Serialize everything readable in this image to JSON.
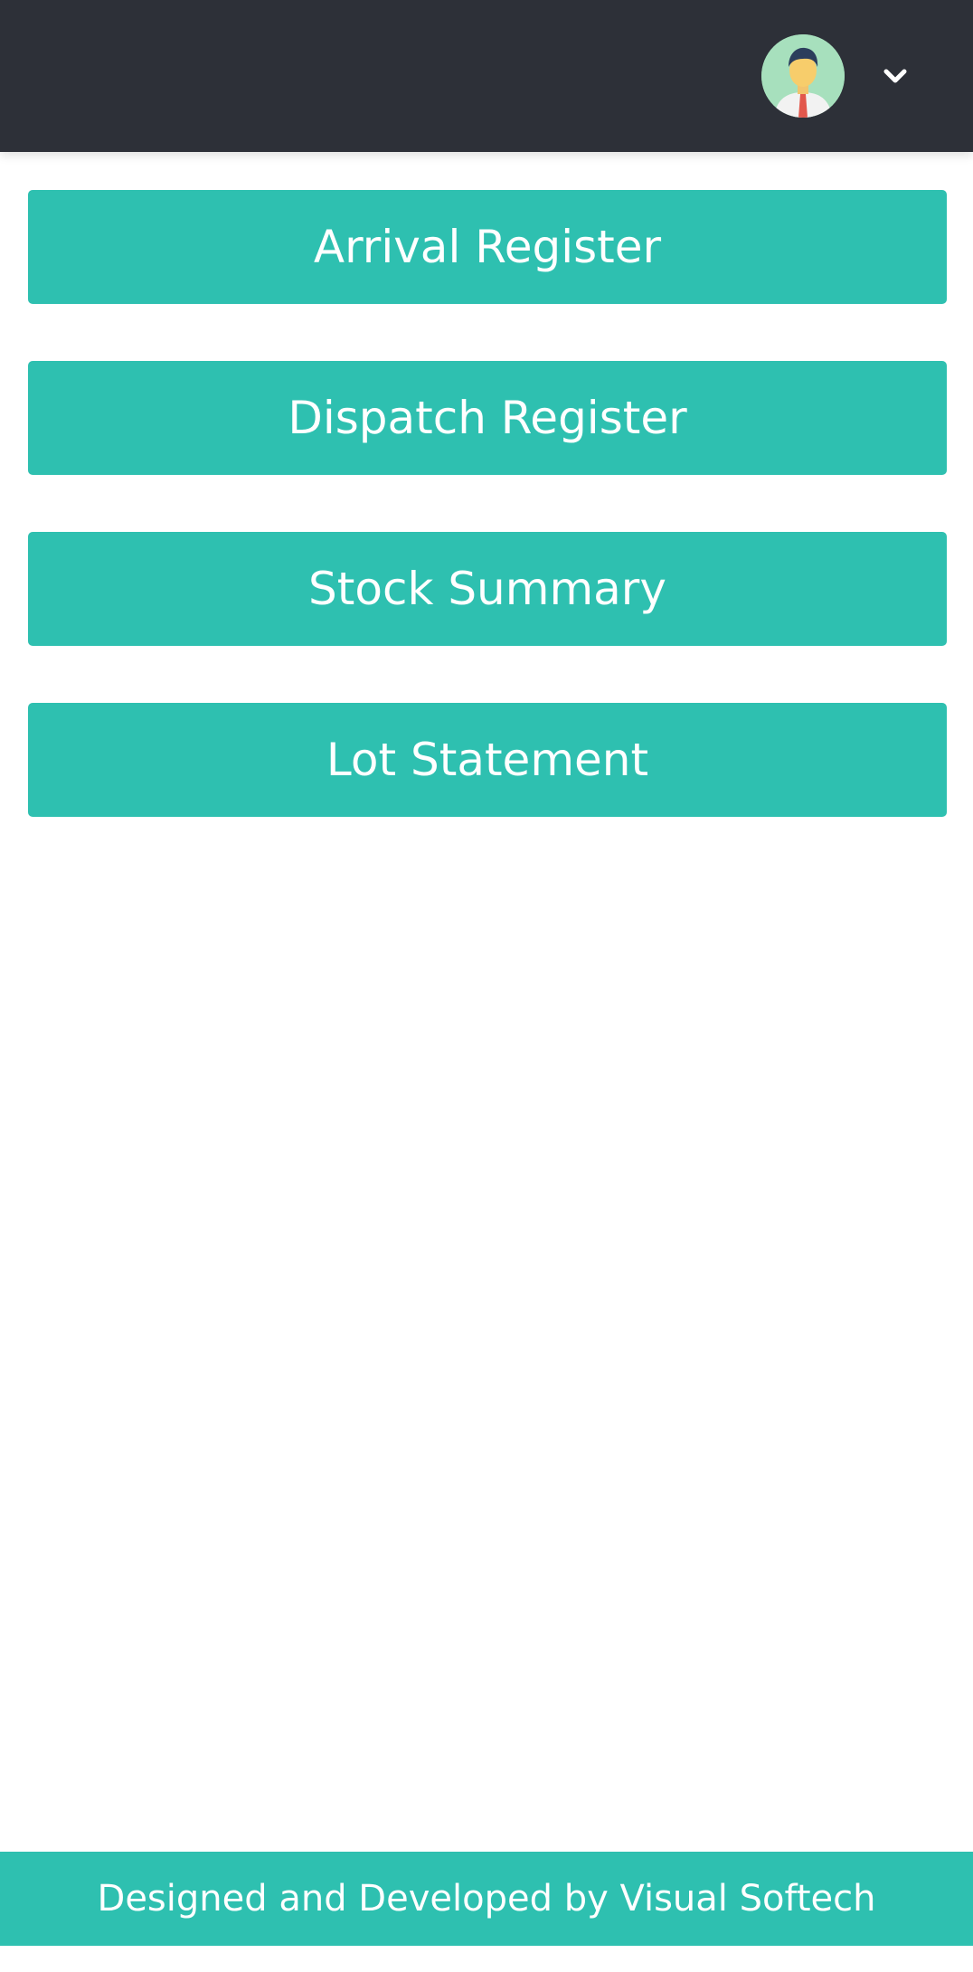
{
  "header": {
    "avatar_icon": "user-avatar-icon",
    "dropdown_icon": "chevron-down-icon",
    "background_color": "#2d3038"
  },
  "menu": {
    "items": [
      {
        "label": "Arrival Register"
      },
      {
        "label": "Dispatch Register"
      },
      {
        "label": "Stock Summary"
      },
      {
        "label": "Lot Statement"
      }
    ],
    "button_color": "#2ec0b0"
  },
  "footer": {
    "text": "Designed and Developed by Visual Softech"
  }
}
